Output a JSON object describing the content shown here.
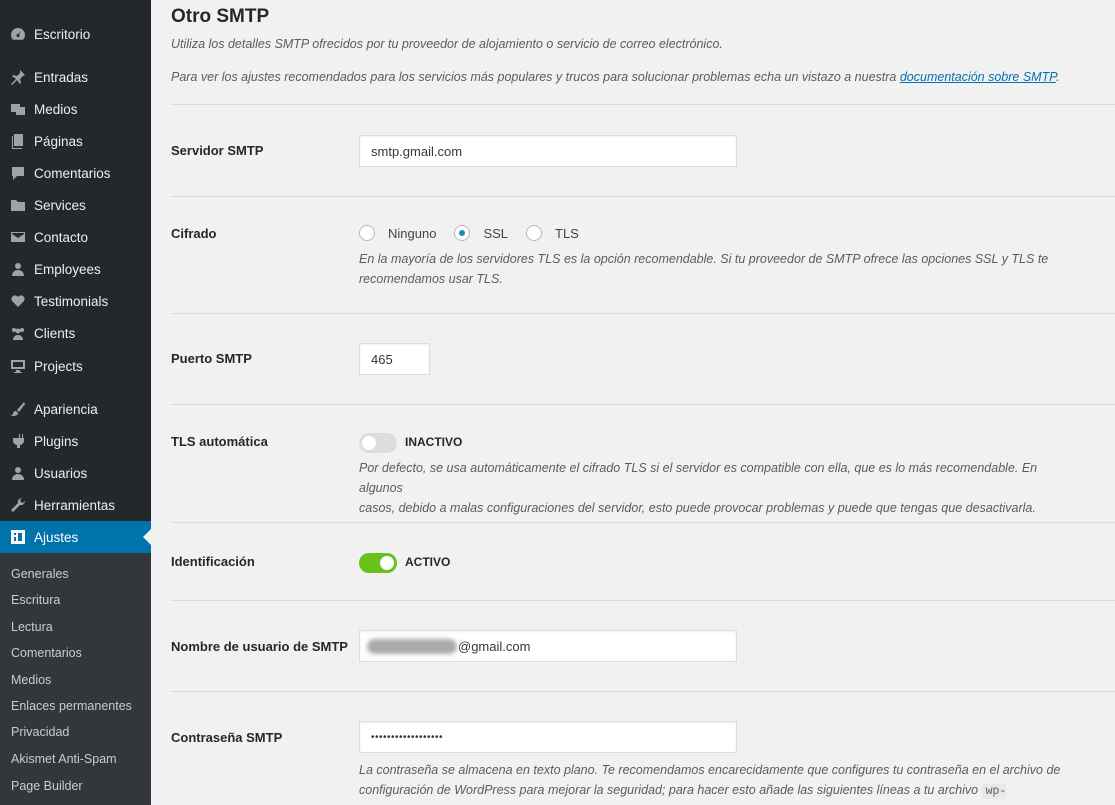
{
  "sidebar": {
    "items": [
      {
        "label": "Escritorio",
        "icon": "dashboard-icon"
      },
      {
        "label": "Entradas",
        "icon": "pin-icon"
      },
      {
        "label": "Medios",
        "icon": "media-icon"
      },
      {
        "label": "Páginas",
        "icon": "pages-icon"
      },
      {
        "label": "Comentarios",
        "icon": "comments-icon"
      },
      {
        "label": "Services",
        "icon": "folder-icon"
      },
      {
        "label": "Contacto",
        "icon": "mail-icon"
      },
      {
        "label": "Employees",
        "icon": "user-icon"
      },
      {
        "label": "Testimonials",
        "icon": "heart-icon"
      },
      {
        "label": "Clients",
        "icon": "groups-icon"
      },
      {
        "label": "Projects",
        "icon": "desktop-icon"
      },
      {
        "label": "Apariencia",
        "icon": "brush-icon"
      },
      {
        "label": "Plugins",
        "icon": "plugin-icon"
      },
      {
        "label": "Usuarios",
        "icon": "users-icon"
      },
      {
        "label": "Herramientas",
        "icon": "wrench-icon"
      },
      {
        "label": "Ajustes",
        "icon": "settings-icon"
      }
    ],
    "submenu": [
      "Generales",
      "Escritura",
      "Lectura",
      "Comentarios",
      "Medios",
      "Enlaces permanentes",
      "Privacidad",
      "Akismet Anti-Spam",
      "Page Builder"
    ]
  },
  "section": {
    "title": "Otro SMTP",
    "desc1": "Utiliza los detalles SMTP ofrecidos por tu proveedor de alojamiento o servicio de correo electrónico.",
    "desc2_before": "Para ver los ajustes recomendados para los servicios más populares y trucos para solucionar problemas echa un vistazo a nuestra ",
    "desc2_link": "documentación sobre SMTP",
    "desc2_after": "."
  },
  "fields": {
    "host_label": "Servidor SMTP",
    "host_value": "smtp.gmail.com",
    "encryption_label": "Cifrado",
    "encryption_options": [
      "Ninguno",
      "SSL",
      "TLS"
    ],
    "encryption_selected": "SSL",
    "encryption_help_1": "En la mayoría de los servidores TLS es la opción recomendable. Si tu proveedor de SMTP ofrece las opciones SSL y TLS te",
    "encryption_help_2": "recomendamos usar TLS.",
    "port_label": "Puerto SMTP",
    "port_value": "465",
    "autotls_label": "TLS automática",
    "autotls_state": "INACTIVO",
    "autotls_help_1": "Por defecto, se usa automáticamente el cifrado TLS si el servidor es compatible con ella, que es lo más recomendable. En algunos",
    "autotls_help_2": "casos, debido a malas configuraciones del servidor, esto puede provocar problemas y puede que tengas que desactivarla.",
    "auth_label": "Identificación",
    "auth_state": "ACTIVO",
    "user_label": "Nombre de usuario de SMTP",
    "user_value": "@gmail.com",
    "pass_label": "Contraseña SMTP",
    "pass_value": "••••••••••••••••••",
    "pass_help_1": "La contraseña se almacena en texto plano. Te recomendamos encarecidamente que configures tu contraseña en el archivo de",
    "pass_help_2": "configuración de WordPress para mejorar la seguridad; para hacer esto añade las siguientes líneas a tu archivo ",
    "pass_help_code": "wp-config.php",
    "pass_help_end": "."
  },
  "colors": {
    "sidebar_bg": "#23282d",
    "active_bg": "#0073aa",
    "toggle_on": "#69c11c",
    "link": "#0073aa"
  }
}
